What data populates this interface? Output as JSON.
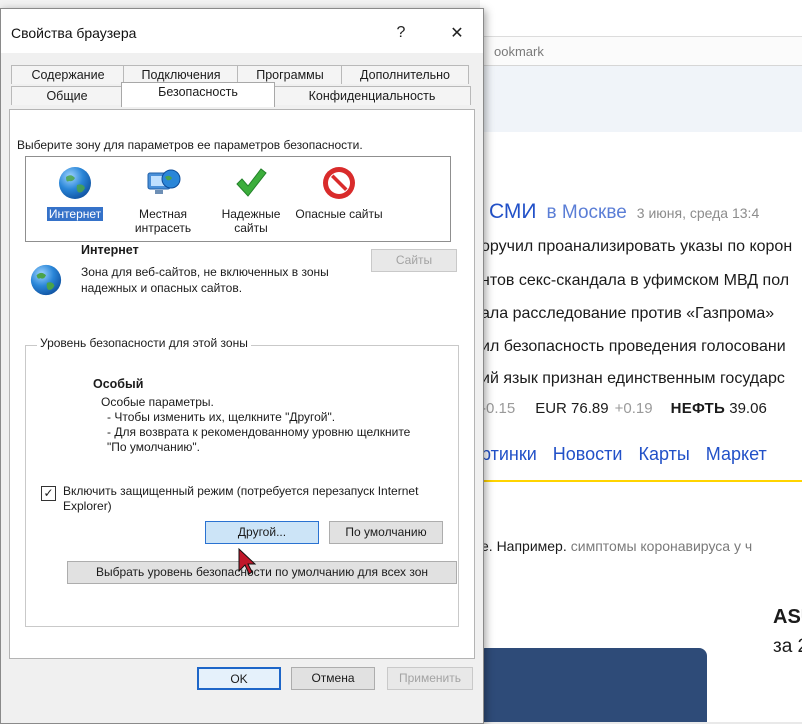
{
  "background_browser": {
    "bookmark_text": "ookmark",
    "headline": {
      "source": "СМИ",
      "city": "в Москве",
      "date": "3 июня, среда 13:4"
    },
    "news": [
      "оручил проанализировать указы по корон",
      "нтов секс-скандала в уфимском МВД пол",
      "ала расследование против «Газпрома»",
      "ил безопасность проведения голосовани",
      "ий язык признан единственным государс"
    ],
    "rates": {
      "delta1": "-0.15",
      "eur_label": "EUR",
      "eur_value": "76.89",
      "eur_delta": "+0.19",
      "oil_label": "НЕФТЬ",
      "oil_value": "39.06"
    },
    "services": [
      "ртинки",
      "Новости",
      "Карты",
      "Маркет"
    ],
    "search_example": {
      "prefix": "е. Например.",
      "query": "симптомы коронавируса у ч"
    },
    "ad": {
      "line1": "ASU",
      "line2": "за 2"
    }
  },
  "dialog": {
    "title": "Свойства браузера",
    "help_glyph": "?",
    "close_glyph": "✕",
    "tabs_back": [
      "Содержание",
      "Подключения",
      "Программы",
      "Дополнительно"
    ],
    "tabs_front": [
      "Общие",
      "Безопасность",
      "Конфиденциальность"
    ],
    "active_tab": "Безопасность",
    "zone_prompt": "Выберите зону для параметров ее параметров безопасности.",
    "zones": [
      {
        "label": "Интернет",
        "icon": "globe-icon",
        "selected": true
      },
      {
        "label": "Местная интрасеть",
        "icon": "intranet-icon",
        "selected": false
      },
      {
        "label": "Надежные сайты",
        "icon": "checkmark-icon",
        "selected": false
      },
      {
        "label": "Опасные сайты",
        "icon": "restricted-icon",
        "selected": false
      }
    ],
    "zone_title": "Интернет",
    "zone_desc": "Зона для веб-сайтов, не включенных в зоны надежных и опасных сайтов.",
    "sites_button": "Сайты",
    "group_legend": "Уровень безопасности для этой зоны",
    "level_title": "Особый",
    "level_lines": [
      "Особые параметры.",
      "- Чтобы изменить их, щелкните \"Другой\".",
      "- Для возврата к рекомендованному уровню щелкните",
      "\"По умолчанию\"."
    ],
    "protected_mode": {
      "checked": true,
      "label": "Включить защищенный режим (потребуется перезапуск Internet Explorer)"
    },
    "custom_button": "Другой...",
    "default_button": "По умолчанию",
    "reset_all_button": "Выбрать уровень безопасности по умолчанию для всех зон",
    "ok_button": "OK",
    "cancel_button": "Отмена",
    "apply_button": "Применить",
    "accent": "#3572c9"
  }
}
